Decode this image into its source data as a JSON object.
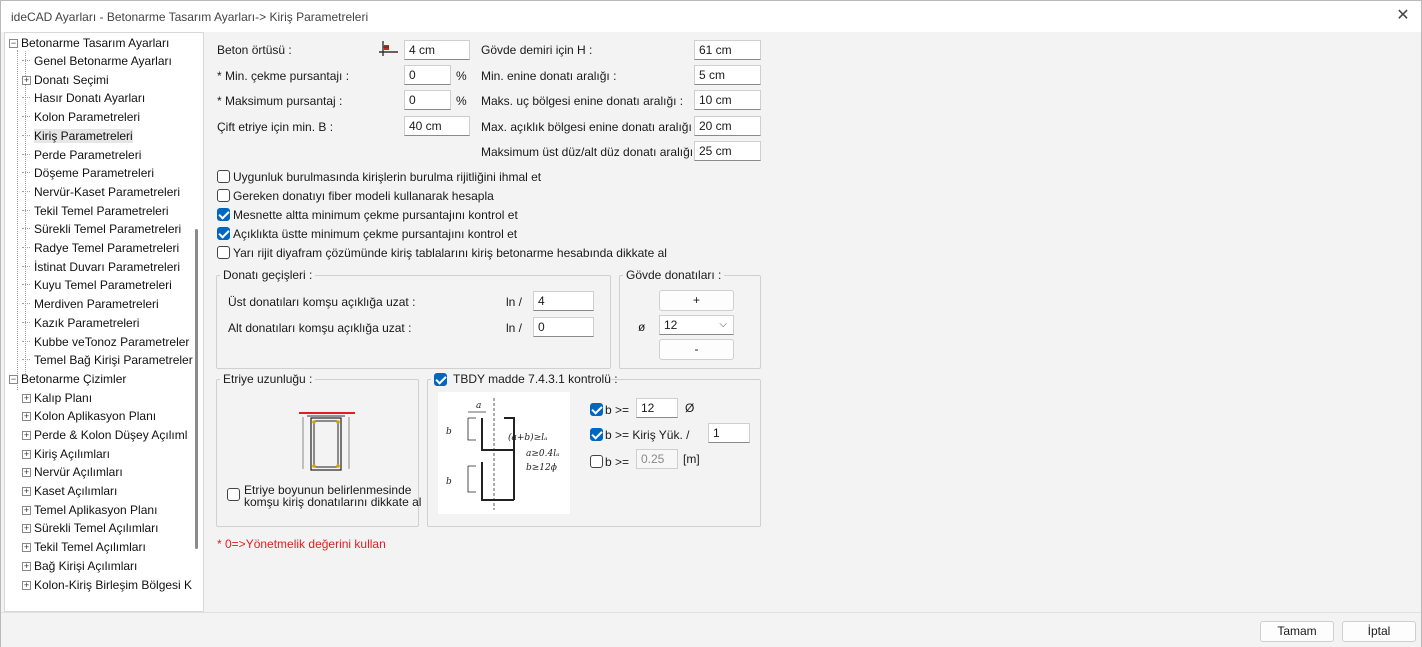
{
  "window": {
    "title": "ideCAD Ayarları - Betonarme Tasarım Ayarları-> Kiriş Parametreleri",
    "close_symbol": "✕"
  },
  "tree": {
    "root1": "Betonarme Tasarım Ayarları",
    "root1_children": [
      {
        "label": "Genel Betonarme Ayarları",
        "expandable": false
      },
      {
        "label": "Donatı Seçimi",
        "expandable": true
      },
      {
        "label": "Hasır Donatı Ayarları",
        "expandable": false
      },
      {
        "label": "Kolon Parametreleri",
        "expandable": false
      },
      {
        "label": "Kiriş Parametreleri",
        "expandable": false,
        "selected": true
      },
      {
        "label": "Perde Parametreleri",
        "expandable": false
      },
      {
        "label": "Döşeme Parametreleri",
        "expandable": false
      },
      {
        "label": "Nervür-Kaset Parametreleri",
        "expandable": false
      },
      {
        "label": "Tekil Temel Parametreleri",
        "expandable": false
      },
      {
        "label": "Sürekli Temel Parametreleri",
        "expandable": false
      },
      {
        "label": "Radye Temel Parametreleri",
        "expandable": false
      },
      {
        "label": "İstinat Duvarı Parametreleri",
        "expandable": false
      },
      {
        "label": "Kuyu Temel Parametreleri",
        "expandable": false
      },
      {
        "label": "Merdiven Parametreleri",
        "expandable": false
      },
      {
        "label": "Kazık Parametreleri",
        "expandable": false
      },
      {
        "label": "Kubbe veTonoz Parametreler",
        "expandable": false
      },
      {
        "label": "Temel Bağ Kirişi Parametreler",
        "expandable": false
      }
    ],
    "root2": "Betonarme Çizimler",
    "root2_children": [
      {
        "label": "Kalıp Planı"
      },
      {
        "label": "Kolon Aplikasyon Planı"
      },
      {
        "label": "Perde & Kolon Düşey Açılıml"
      },
      {
        "label": "Kiriş Açılımları"
      },
      {
        "label": "Nervür Açılımları"
      },
      {
        "label": "Kaset Açılımları"
      },
      {
        "label": "Temel Aplikasyon Planı"
      },
      {
        "label": "Sürekli Temel Açılımları"
      },
      {
        "label": "Tekil Temel Açılımları"
      },
      {
        "label": "Bağ Kirişi Açılımları"
      },
      {
        "label": "Kolon-Kiriş Birleşim Bölgesi K"
      }
    ]
  },
  "fields": {
    "beton_ortusu": {
      "label": "Beton örtüsü :",
      "value": "4 cm"
    },
    "min_cekme": {
      "label": "* Min. çekme pursantajı :",
      "value": "0",
      "unit": "%"
    },
    "maks_pursantaj": {
      "label": "* Maksimum pursantaj :",
      "value": "0",
      "unit": "%"
    },
    "cift_etriye": {
      "label": "Çift etriye için min. B :",
      "value": "40 cm"
    },
    "govde_demiri": {
      "label": "Gövde demiri için H :",
      "value": "61 cm"
    },
    "min_enine": {
      "label": "Min. enine donatı aralığı :",
      "value": "5 cm"
    },
    "maks_uc": {
      "label": "Maks. uç bölgesi enine donatı aralığı :",
      "value": "10 cm"
    },
    "max_aciklik": {
      "label": "Max. açıklık bölgesi enine donatı aralığı :",
      "value": "20 cm"
    },
    "maks_ust": {
      "label": "Maksimum üst düz/alt düz donatı aralığı :",
      "value": "25 cm"
    }
  },
  "checkboxes": [
    {
      "label": "Uygunluk burulmasında kirişlerin burulma rijitliğini ihmal et",
      "checked": false
    },
    {
      "label": "Gereken donatıyı fiber modeli kullanarak hesapla",
      "checked": false
    },
    {
      "label": "Mesnette altta minimum çekme pursantajını kontrol et",
      "checked": true
    },
    {
      "label": "Açıklıkta üstte minimum çekme pursantajını kontrol et",
      "checked": true
    },
    {
      "label": "Yarı rijit diyafram çözümünde kiriş tablalarını kiriş betonarme hesabında dikkate al",
      "checked": false
    }
  ],
  "donati_gecisleri": {
    "title": "Donatı geçişleri :",
    "ust_label": "Üst donatıları komşu açıklığa uzat :",
    "ust_prefix": "ln /",
    "ust_value": "4",
    "alt_label": "Alt donatıları komşu açıklığa uzat :",
    "alt_prefix": "ln /",
    "alt_value": "0"
  },
  "govde_donatilari": {
    "title": "Gövde donatıları :",
    "plus_label": "+",
    "minus_label": "-",
    "diameter_symbol": "ø",
    "selected_diameter": "12"
  },
  "etriye": {
    "title": "Etriye uzunluğu :",
    "checkbox_label_line1": "Etriye boyunun belirlenmesinde",
    "checkbox_label_line2": "komşu kiriş donatılarını dikkate al",
    "checked": false
  },
  "tbdy": {
    "title": "TBDY madde 7.4.3.1 kontrolü :",
    "checked": true,
    "rule1": {
      "label": "b >=",
      "value": "12",
      "unit": "Ø",
      "checked": true
    },
    "rule2": {
      "label": "b >= Kiriş Yük. /",
      "value": "1",
      "checked": true
    },
    "rule3": {
      "label": "b >=",
      "value": "0.25",
      "unit": "[m]",
      "checked": false
    },
    "sketch_text": {
      "a": "a",
      "b": "b",
      "eq1": "(a+b)≥lₐ",
      "eq2": "a≥0.4lₐ",
      "eq3": "b≥12ϕ"
    }
  },
  "note": "* 0=>Yönetmelik değerini kullan",
  "footer": {
    "ok_label": "Tamam",
    "cancel_label": "İptal"
  },
  "colors": {
    "accent": "#0067c0",
    "note": "#e02020",
    "beam_red": "#e02020"
  }
}
